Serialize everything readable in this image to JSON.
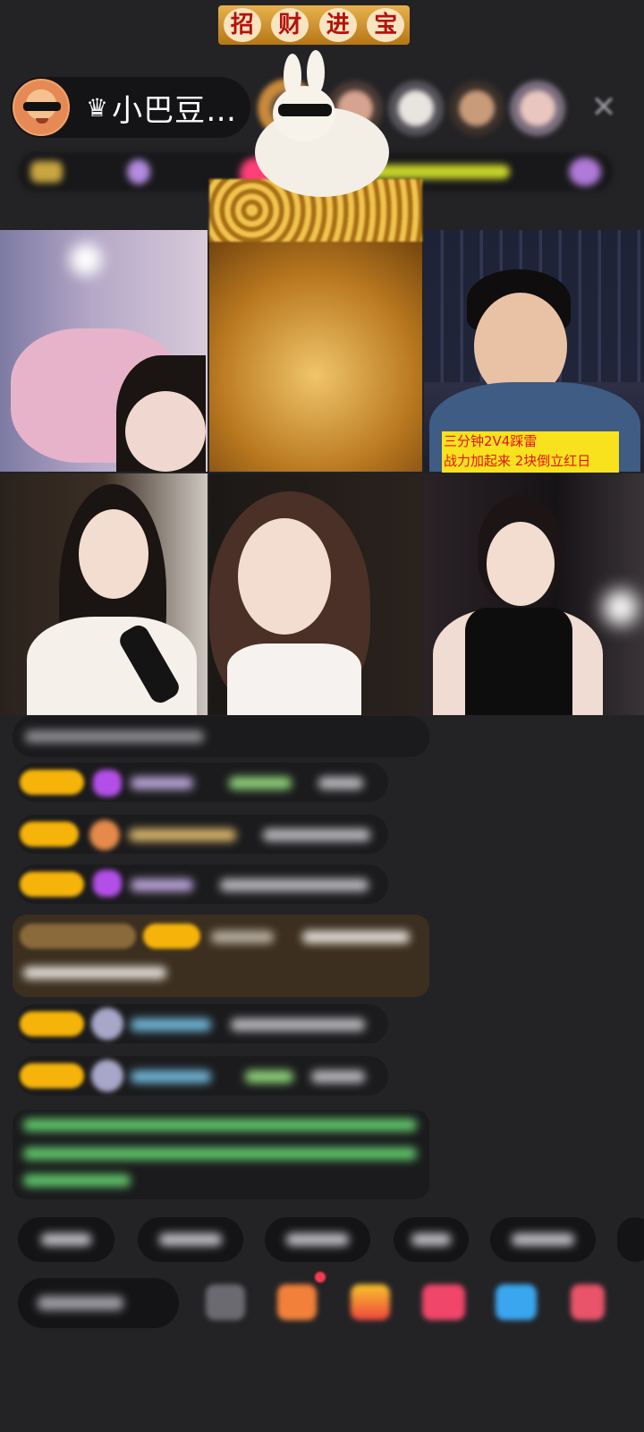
{
  "header": {
    "host_name": "小巴豆…",
    "host_badge_icon": "crown-icon",
    "viewer_avatars": [
      "viewer-1",
      "viewer-2",
      "viewer-3",
      "viewer-4",
      "viewer-5"
    ],
    "close_icon": "close-icon"
  },
  "video_grid": {
    "tiles": [
      {
        "name": "tile-1"
      },
      {
        "name": "tile-2",
        "banner": [
          "招",
          "财",
          "进",
          "宝"
        ]
      },
      {
        "name": "tile-3",
        "caption_line1": "三分钟2V4踩雷",
        "caption_line2": "战力加起来 2块倒立红日"
      },
      {
        "name": "tile-4"
      },
      {
        "name": "tile-5"
      },
      {
        "name": "tile-6"
      }
    ]
  },
  "colors": {
    "background": "#232326",
    "badge_yellow": "#f6b40a",
    "caption_bg": "#f8e21d",
    "caption_text": "#e3131d",
    "notice_green": "#5fc46a"
  },
  "bottom_bar": {
    "icons": [
      "gift-icon",
      "lucky-bag-icon",
      "shop-icon",
      "heart-icon",
      "game-icon",
      "more-icon"
    ]
  }
}
